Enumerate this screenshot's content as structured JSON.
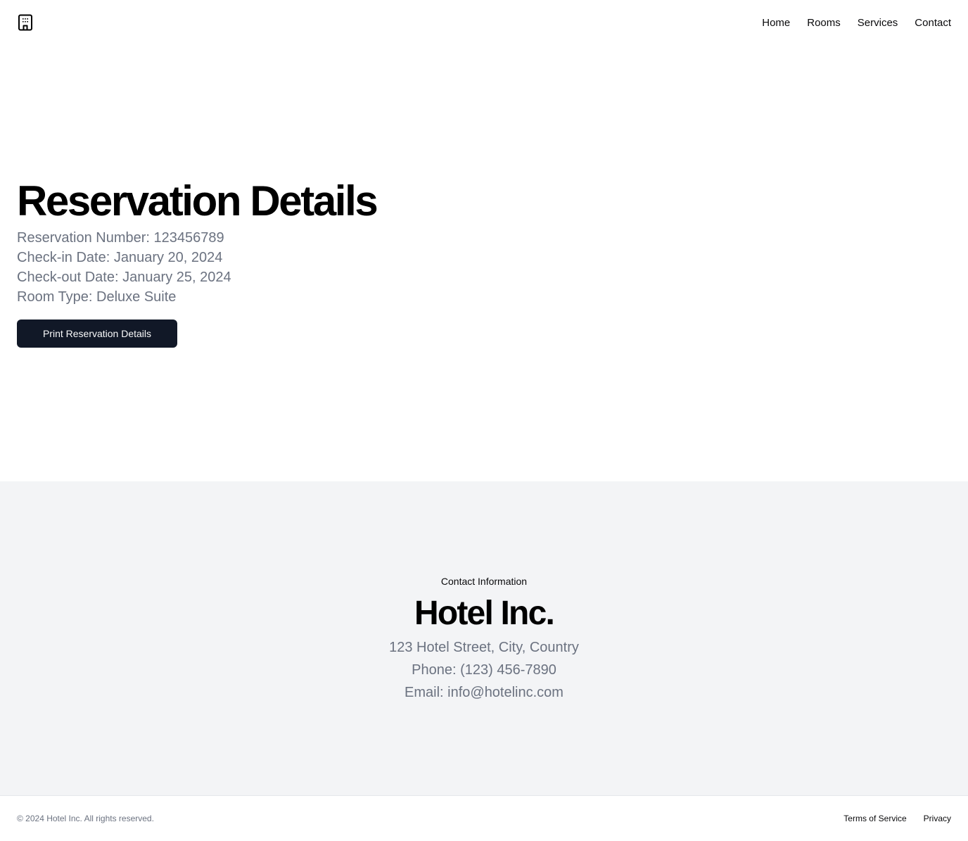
{
  "header": {
    "logo_icon": "hotel-building-icon",
    "nav": [
      {
        "label": "Home"
      },
      {
        "label": "Rooms"
      },
      {
        "label": "Services"
      },
      {
        "label": "Contact"
      }
    ]
  },
  "reservation": {
    "title": "Reservation Details",
    "number": "Reservation Number: 123456789",
    "check_in": "Check-in Date: January 20, 2024",
    "check_out": "Check-out Date: January 25, 2024",
    "room_type": "Room Type: Deluxe Suite",
    "print_label": "Print Reservation Details"
  },
  "contact": {
    "eyebrow": "Contact Information",
    "company": "Hotel Inc.",
    "address": "123 Hotel Street, City, Country",
    "phone": "Phone: (123) 456-7890",
    "email": "Email: info@hotelinc.com"
  },
  "footer": {
    "copyright": "© 2024 Hotel Inc. All rights reserved.",
    "links": [
      {
        "label": "Terms of Service"
      },
      {
        "label": "Privacy"
      }
    ]
  },
  "colors": {
    "button_bg": "#111827",
    "muted_text": "#6b7280",
    "section_bg": "#f3f4f6"
  }
}
